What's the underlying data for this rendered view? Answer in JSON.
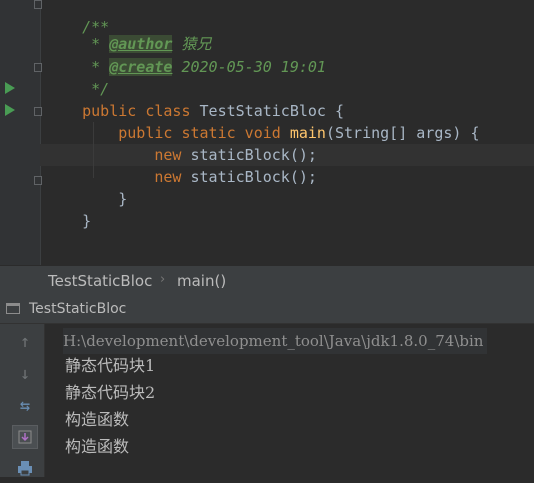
{
  "editor": {
    "comment_open": "/**",
    "author_tag": "@author",
    "author_value": "猿兄",
    "create_tag": "@create",
    "create_value": "2020-05-30 19:01",
    "comment_close": "*/",
    "class_kw": "public class",
    "class_name": "TestStaticBloc",
    "brace_open": "{",
    "method_mods": "public static void",
    "method_name": "main",
    "method_params": "(String[] args) {",
    "new_kw": "new",
    "stmt": "staticBlock();",
    "brace_close": "}"
  },
  "breadcrumb": {
    "class_name": "TestStaticBloc",
    "method": "main()"
  },
  "run_window": {
    "tab_label": "TestStaticBloc",
    "console": {
      "command": "H:\\development\\development_tool\\Java\\jdk1.8.0_74\\bin",
      "output": [
        "静态代码块1",
        "静态代码块2",
        "构造函数",
        "构造函数"
      ]
    }
  },
  "colors": {
    "background": "#2b2b2b",
    "keyword": "#cc7832",
    "function": "#ffc66d",
    "comment": "#629755",
    "run_icon": "#499c54"
  }
}
